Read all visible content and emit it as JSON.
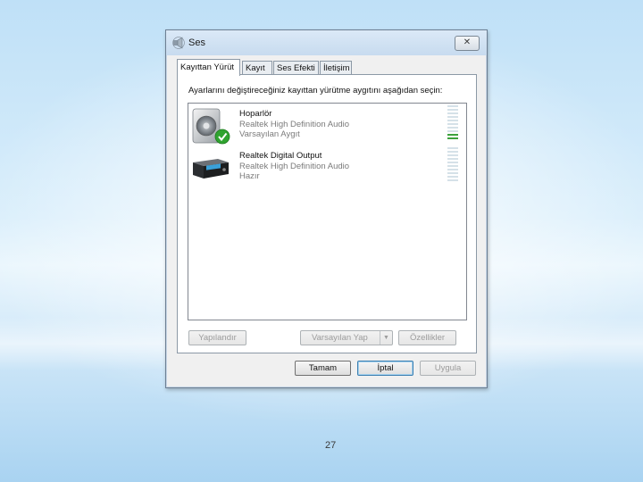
{
  "window": {
    "title": "Ses",
    "close_glyph": "✕"
  },
  "tabs": [
    {
      "label": "Kayıttan Yürüt",
      "active": true
    },
    {
      "label": "Kayıt",
      "active": false
    },
    {
      "label": "Ses Efekti",
      "active": false
    },
    {
      "label": "İletişim",
      "active": false
    }
  ],
  "instruction": "Ayarlarını değiştireceğiniz kayıttan yürütme aygıtını aşağıdan seçin:",
  "devices": [
    {
      "name": "Hoparlör",
      "driver": "Realtek High Definition Audio",
      "status": "Varsayılan Aygıt",
      "icon": "speaker-icon",
      "default": true,
      "meter_level": 0.2
    },
    {
      "name": "Realtek Digital Output",
      "driver": "Realtek High Definition Audio",
      "status": "Hazır",
      "icon": "digital-output-device-icon",
      "default": false,
      "meter_level": 0
    }
  ],
  "buttons": {
    "configure": "Yapılandır",
    "set_default": "Varsayılan Yap",
    "properties": "Özellikler",
    "ok": "Tamam",
    "cancel": "İptal",
    "apply": "Uygula"
  },
  "slide": {
    "page_number": "27"
  },
  "colors": {
    "meter_active": "#3da23d",
    "meter_inactive": "#d5e1e8",
    "default_check": "#2fa32f"
  }
}
